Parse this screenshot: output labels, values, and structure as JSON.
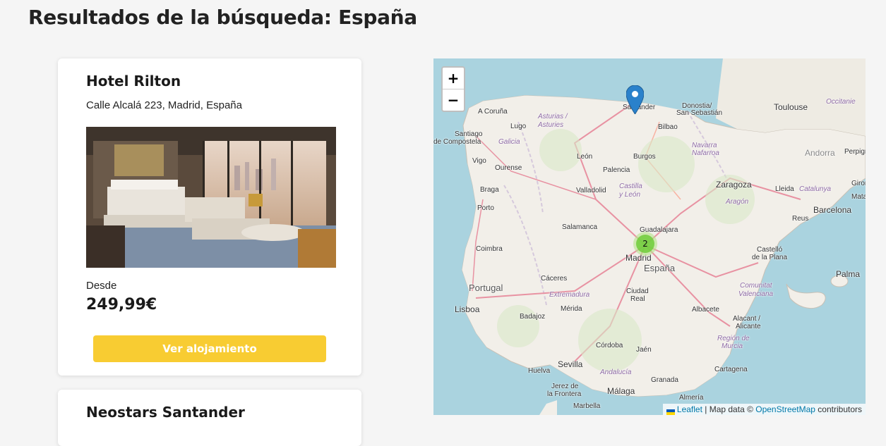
{
  "page": {
    "title": "Resultados de la búsqueda: España"
  },
  "hotels": [
    {
      "name": "Hotel Rilton",
      "address": "Calle Alcalá 223, Madrid, España",
      "price_from_label": "Desde",
      "price": "249,99€",
      "button_label": "Ver alojamiento"
    },
    {
      "name": "Neostars Santander"
    }
  ],
  "map": {
    "zoom_in": "+",
    "zoom_out": "−",
    "cluster_count": "2",
    "attribution": {
      "leaflet": "Leaflet",
      "sep": " | Map data © ",
      "osm": "OpenStreetMap",
      "suffix": " contributors"
    },
    "labels": {
      "coruna": "A Coruña",
      "asturias": "Asturias /",
      "asturias2": "Asturies",
      "santander": "Santander",
      "donostia": "Donostia/",
      "sansebastian": "San Sebastián",
      "bilbao": "Bilbao",
      "toulouse": "Toulouse",
      "occitanie": "Occitanie",
      "santiago": "Santiago",
      "decompostela": "de Compostela",
      "galicia": "Galicia",
      "lugo": "Lugo",
      "vigo": "Vigo",
      "ourense": "Ourense",
      "leon": "León",
      "burgos": "Burgos",
      "navarra": "Navarra",
      "nafarroa": "Nafarroa",
      "andorra": "Andorra",
      "perpignan": "Perpign",
      "palencia": "Palencia",
      "braga": "Braga",
      "porto": "Porto",
      "valladolid": "Valladolid",
      "castilla": "Castilla",
      "yleon": "y León",
      "zaragoza": "Zaragoza",
      "lleida": "Lleida",
      "catalunya": "Catalunya",
      "girona": "Giron",
      "aragon": "Aragón",
      "barcelona": "Barcelona",
      "mataro": "Matar",
      "reus": "Reus",
      "salamanca": "Salamanca",
      "guadalajara": "Guadalajara",
      "coimbra": "Coimbra",
      "madrid": "Madrid",
      "espana": "España",
      "castello": "Castelló",
      "delaplana": "de la Plana",
      "palma": "Palma",
      "caceres": "Cáceres",
      "portugal": "Portugal",
      "extremadura": "Extremadura",
      "ciudad": "Ciudad",
      "real": "Real",
      "comunitat": "Comunitat",
      "valenciana": "Valenciana",
      "lisboa": "Lisboa",
      "merida": "Mérida",
      "badajoz": "Badajoz",
      "albacete": "Albacete",
      "alacant": "Alacant /",
      "alicante": "Alicante",
      "regionde": "Región de",
      "murcia": "Murcia",
      "cordoba": "Córdoba",
      "jaen": "Jaén",
      "sevilla": "Sevilla",
      "huelva": "Huelva",
      "andalucia": "Andalucía",
      "cartagena": "Cartagena",
      "granada": "Granada",
      "jerez": "Jerez de",
      "lafrontera": "la Frontera",
      "malaga": "Málaga",
      "almeria": "Almería",
      "marbella": "Marbella"
    }
  }
}
